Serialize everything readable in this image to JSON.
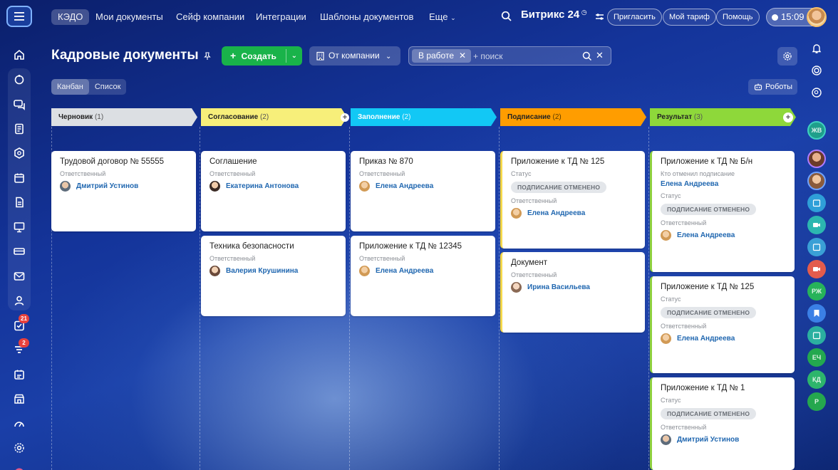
{
  "nav": {
    "items": [
      "КЭДО",
      "Мои документы",
      "Сейф компании",
      "Интеграции",
      "Шаблоны документов",
      "Еще"
    ],
    "brand": "Битрикс 24",
    "invite": "Пригласить",
    "tariff": "Мой тариф",
    "help": "Помощь",
    "time": "15:09"
  },
  "sidebar": {
    "badges": {
      "tasks": "21",
      "feed": "2"
    }
  },
  "header": {
    "title": "Кадровые документы",
    "create_label": "Создать",
    "company_label": "От компании",
    "filter_chip": "В работе",
    "search_placeholder": "+ поиск",
    "views": [
      "Канбан",
      "Список"
    ],
    "robots_label": "Роботы"
  },
  "right_sidebar": {
    "initials": [
      "ЖВ",
      "РЖ",
      "ЕЧ",
      "КД",
      "Р"
    ]
  },
  "columns": [
    {
      "name": "Черновик",
      "count": "(1)",
      "color": "#dcdfe3"
    },
    {
      "name": "Согласование",
      "count": "(2)",
      "color": "#f7ef7a"
    },
    {
      "name": "Заполнение",
      "count": "(2)",
      "color": "#12c8f5"
    },
    {
      "name": "Подписание",
      "count": "(2)",
      "color": "#ff9d00"
    },
    {
      "name": "Результат",
      "count": "(3)",
      "color": "#8ed83a"
    }
  ],
  "labels": {
    "responsible": "Ответственный",
    "status": "Статус",
    "cancelled_by": "Кто отменил подписание",
    "cancelled": "ПОДПИСАНИЕ ОТМЕНЕНО"
  },
  "cards": {
    "c1": {
      "title": "Трудовой договор № 55555",
      "person": "Дмитрий Устинов"
    },
    "c2": {
      "title": "Соглашение",
      "person": "Екатерина Антонова"
    },
    "c3": {
      "title": "Техника безопасности",
      "person": "Валерия Крушинина"
    },
    "c4": {
      "title": "Приказ № 870",
      "person": "Елена Андреева"
    },
    "c5": {
      "title": "Приложение к ТД № 12345",
      "person": "Елена Андреева"
    },
    "c6": {
      "title": "Приложение к ТД № 125",
      "person": "Елена Андреева"
    },
    "c7": {
      "title": "Документ",
      "person": "Ирина Васильева"
    },
    "c8": {
      "title": "Приложение к ТД № Б/н",
      "cancelled_by": "Елена Андреева",
      "person": "Елена Андреева"
    },
    "c9": {
      "title": "Приложение к ТД № 125",
      "person": "Елена Андреева"
    },
    "c10": {
      "title": "Приложение к ТД № 1",
      "person": "Дмитрий Устинов"
    }
  }
}
